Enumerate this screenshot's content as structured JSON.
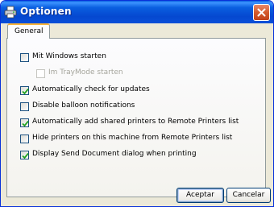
{
  "window": {
    "title": "Optionen"
  },
  "tabs": [
    {
      "label": "General"
    }
  ],
  "options": [
    {
      "label": "Mit Windows starten",
      "checked": false,
      "enabled": true
    },
    {
      "label": "Im TrayMode starten",
      "checked": false,
      "enabled": false
    },
    {
      "label": "Automatically check for updates",
      "checked": true,
      "enabled": true
    },
    {
      "label": "Disable balloon notifications",
      "checked": false,
      "enabled": true
    },
    {
      "label": "Automatically add shared printers to Remote Printers list",
      "checked": true,
      "enabled": true
    },
    {
      "label": "Hide printers on this machine from Remote Printers list",
      "checked": false,
      "enabled": true
    },
    {
      "label": "Display Send Document dialog when printing",
      "checked": true,
      "enabled": true
    }
  ],
  "buttons": {
    "accept": "Aceptar",
    "cancel": "Cancelar"
  }
}
